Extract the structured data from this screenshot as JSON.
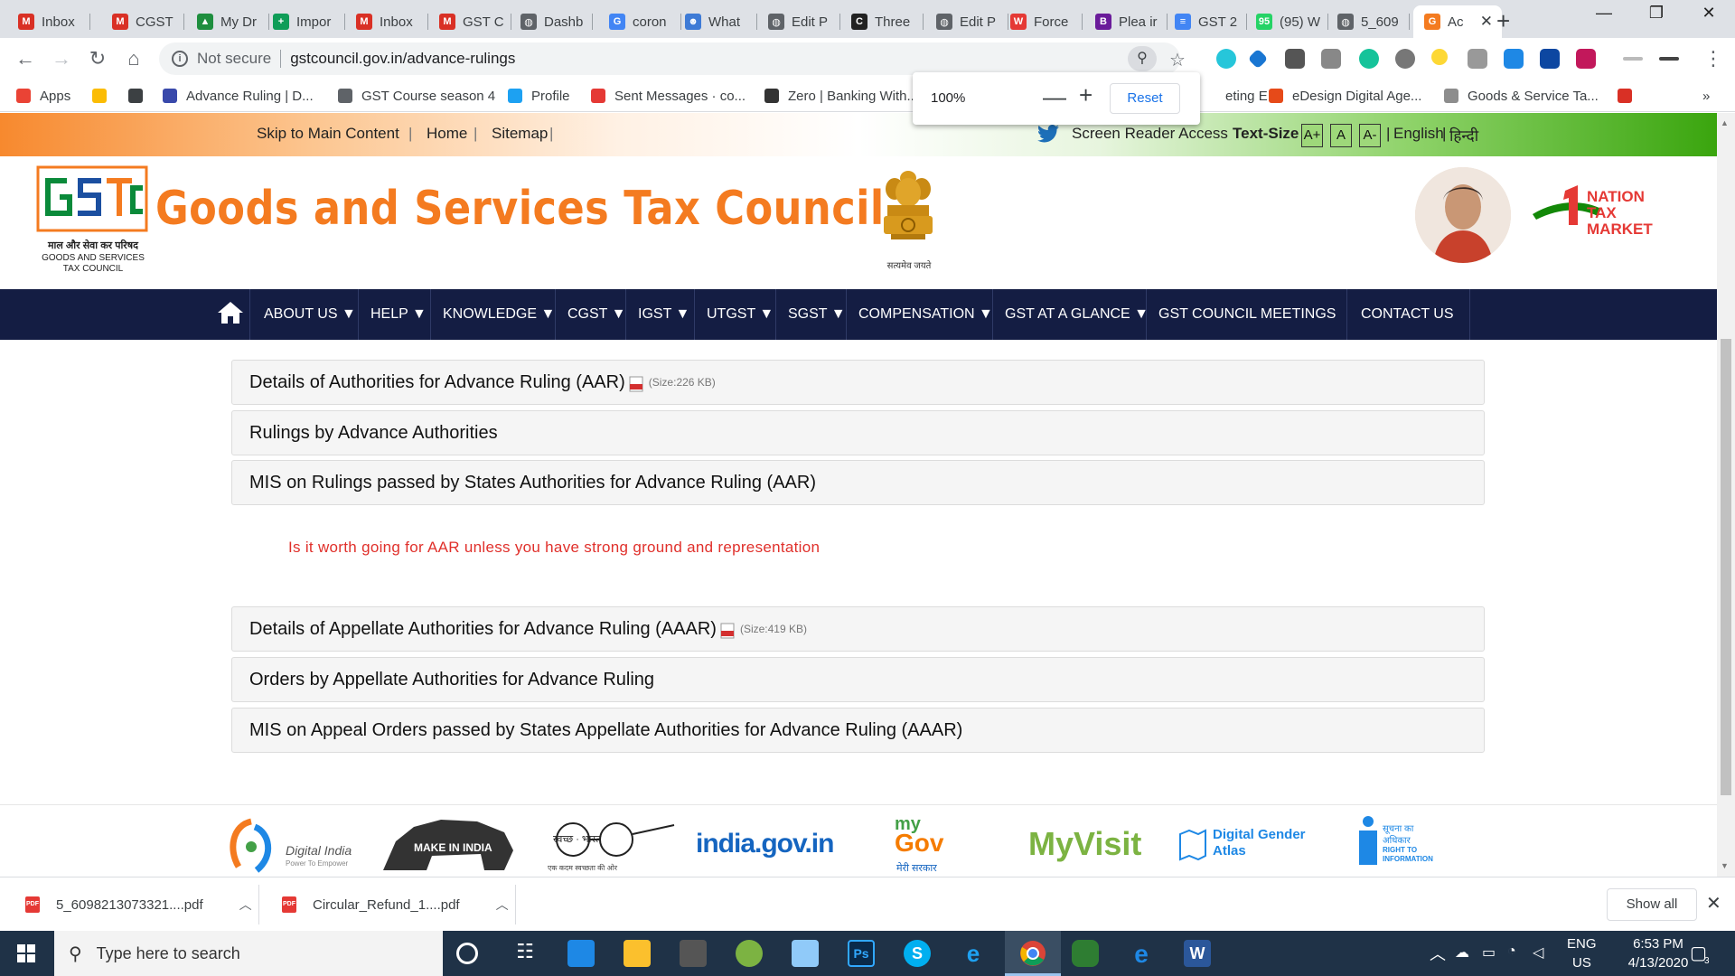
{
  "browser": {
    "tabs": [
      {
        "label": "Inbox",
        "color": "#d93025",
        "glyph": "M"
      },
      {
        "label": "CGST",
        "color": "#d93025",
        "glyph": "M"
      },
      {
        "label": "My Dr",
        "color": "#1e8e3e",
        "glyph": "▲"
      },
      {
        "label": "Impor",
        "color": "#0f9d58",
        "glyph": "+"
      },
      {
        "label": "Inbox",
        "color": "#d93025",
        "glyph": "M"
      },
      {
        "label": "GST C",
        "color": "#d93025",
        "glyph": "M"
      },
      {
        "label": "Dashb",
        "color": "#5f6368",
        "glyph": "◍"
      },
      {
        "label": "coron",
        "color": "#4285f4",
        "glyph": "G"
      },
      {
        "label": "What",
        "color": "#3e7bd6",
        "glyph": "☻"
      },
      {
        "label": "Edit P",
        "color": "#5f6368",
        "glyph": "◍"
      },
      {
        "label": "Three",
        "color": "#222222",
        "glyph": "C"
      },
      {
        "label": "Edit P",
        "color": "#5f6368",
        "glyph": "◍"
      },
      {
        "label": "Force",
        "color": "#e53935",
        "glyph": "W"
      },
      {
        "label": "Plea ir",
        "color": "#6a1b9a",
        "glyph": "B"
      },
      {
        "label": "GST 2",
        "color": "#4285f4",
        "glyph": "≡"
      },
      {
        "label": "(95) W",
        "color": "#25d366",
        "glyph": "95"
      },
      {
        "label": "5_609",
        "color": "#5f6368",
        "glyph": "◍"
      },
      {
        "label": "Ac",
        "color": "#f47b20",
        "glyph": "G"
      }
    ],
    "new_tab": "+",
    "url_secure": "Not secure",
    "url": "gstcouncil.gov.in/advance-rulings",
    "bookmarks": [
      {
        "label": "Apps",
        "color": "#ea4335"
      },
      {
        "label": "",
        "color": "#fbbc04"
      },
      {
        "label": "",
        "color": "#3c4043"
      },
      {
        "label": "Advance Ruling | D...",
        "color": "#3949ab"
      },
      {
        "label": "GST Course season 4",
        "color": "#5f6368"
      },
      {
        "label": "Profile",
        "color": "#1da1f2"
      },
      {
        "label": "Sent Messages · co...",
        "color": "#e53935"
      },
      {
        "label": "Zero | Banking With...",
        "color": "#333333"
      },
      {
        "label": "eting E...",
        "color": "#ffffff"
      },
      {
        "label": "eDesign Digital Age...",
        "color": "#e64a19"
      },
      {
        "label": "Goods & Service Ta...",
        "color": "#8d8d8d"
      },
      {
        "label": "",
        "color": "#d93025"
      }
    ],
    "zoom": {
      "level": "100%",
      "minus": "—",
      "plus": "+",
      "reset": "Reset"
    }
  },
  "site": {
    "top_links": [
      "Skip to Main Content",
      "Home",
      "Sitemap"
    ],
    "screen_reader": "Screen Reader Access",
    "text_size_label": "Text-Size",
    "text_sizes": [
      "A+",
      "A",
      "A-"
    ],
    "lang_en": "English",
    "lang_hi": "हिन्दी",
    "logo_hindi": "माल और सेवा कर परिषद",
    "logo_en1": "GOODS AND SERVICES",
    "logo_en2": "TAX COUNCIL",
    "title": "Goods and Services Tax Council",
    "emblem_caption": "सत्यमेव जयते",
    "nav": [
      "ABOUT US ▼",
      "HELP ▼",
      "KNOWLEDGE ▼",
      "CGST ▼",
      "IGST ▼",
      "UTGST ▼",
      "SGST ▼",
      "COMPENSATION ▼",
      "GST AT A GLANCE ▼",
      "GST COUNCIL MEETINGS",
      "CONTACT US"
    ],
    "accordion_top": [
      {
        "label": "Details of Authorities for Advance Ruling (AAR)",
        "size": "(Size:226 KB)"
      },
      {
        "label": "Rulings by Advance Authorities",
        "size": ""
      },
      {
        "label": "MIS on Rulings passed by States Authorities for Advance Ruling (AAR)",
        "size": ""
      }
    ],
    "note": "Is it worth going for AAR unless you have strong ground and representation",
    "accordion_bottom": [
      {
        "label": "Details of Appellate Authorities for Advance Ruling (AAAR)",
        "size": "(Size:419 KB)"
      },
      {
        "label": "Orders by Appellate Authorities for Advance Ruling",
        "size": ""
      },
      {
        "label": "MIS on Appeal Orders passed by States Appellate Authorities for Advance Ruling (AAAR)",
        "size": ""
      }
    ],
    "footer": {
      "digital_india": "Digital India",
      "digital_india_sub": "Power To Empower",
      "make_in_india": "MAKE IN INDIA",
      "swachh": "स्वच्छ · भारत",
      "swachh_sub": "एक कदम स्वच्छता की ओर",
      "india_gov": "india.gov.in",
      "mygov1": "my",
      "mygov2": "Gov",
      "mygov3": "मेरी सरकार",
      "myvisit": "MyVisit",
      "gender1": "Digital Gender",
      "gender2": "Atlas",
      "rti1": "सूचना का",
      "rti2": "अधिकार",
      "rti3": "RIGHT TO",
      "rti4": "INFORMATION"
    }
  },
  "downloads": {
    "items": [
      "5_6098213073321....pdf",
      "Circular_Refund_1....pdf"
    ],
    "show_all": "Show all"
  },
  "taskbar": {
    "search_placeholder": "Type here to search",
    "lang1": "ENG",
    "lang2": "US",
    "time": "6:53 PM",
    "date": "4/13/2020",
    "notifications": "3"
  }
}
